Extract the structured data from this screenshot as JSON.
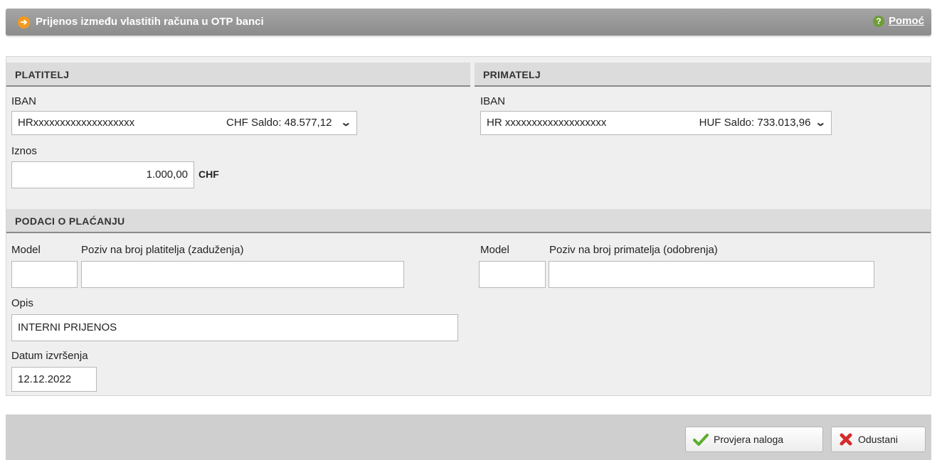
{
  "header": {
    "title": "Prijenos između vlastitih računa u OTP banci",
    "help_label": "Pomoć"
  },
  "payer": {
    "section_title": "PLATITELJ",
    "iban_label": "IBAN",
    "iban_value": "HRxxxxxxxxxxxxxxxxxxx",
    "account_balance": "CHF Saldo: 48.577,12",
    "amount_label": "Iznos",
    "amount_value": "1.000,00",
    "currency": "CHF"
  },
  "recipient": {
    "section_title": "PRIMATELJ",
    "iban_label": "IBAN",
    "iban_value": "HR xxxxxxxxxxxxxxxxxxx",
    "account_balance": "HUF Saldo: 733.013,96"
  },
  "payment": {
    "section_title": "PODACI O PLAĆANJU",
    "payer_model_label": "Model",
    "payer_reference_label": "Poziv na broj platitelja (zaduženja)",
    "payer_model_value": "",
    "payer_reference_value": "",
    "recipient_model_label": "Model",
    "recipient_reference_label": "Poziv na broj primatelja (odobrenja)",
    "recipient_model_value": "",
    "recipient_reference_value": "",
    "description_label": "Opis",
    "description_value": "INTERNI PRIJENOS",
    "date_label": "Datum izvršenja",
    "date_value": "12.12.2022"
  },
  "actions": {
    "check_label": "Provjera naloga",
    "cancel_label": "Odustani"
  },
  "colors": {
    "accent_orange": "#f39a1e",
    "check_green": "#5aae2a",
    "cancel_red": "#d62b2b",
    "help_green": "#6e9e36"
  },
  "icons": {
    "title": "arrow-right-icon",
    "help": "question-icon",
    "check": "checkmark-icon",
    "cancel": "cross-icon"
  }
}
